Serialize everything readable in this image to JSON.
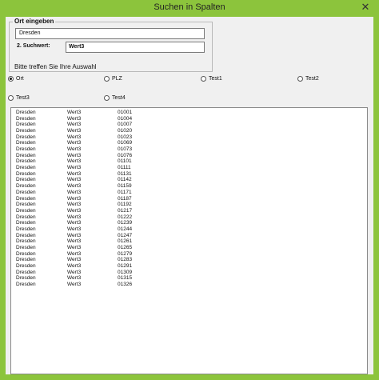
{
  "window": {
    "title": "Suchen in Spalten",
    "close_label": "✕"
  },
  "ort_frame": {
    "label": "Ort eingeben",
    "value": "Dresden"
  },
  "suchwert": {
    "label": "2. Suchwert:",
    "value": "Wert3"
  },
  "prompt": "Bitte treffen Sie Ihre Auswahl",
  "options": [
    {
      "label": "Ort",
      "checked": true
    },
    {
      "label": "PLZ",
      "checked": false
    },
    {
      "label": "Test1",
      "checked": false
    },
    {
      "label": "Test2",
      "checked": false
    },
    {
      "label": "Test3",
      "checked": false
    },
    {
      "label": "Test4",
      "checked": false
    }
  ],
  "results": [
    [
      "Dresden",
      "Wert3",
      "01001"
    ],
    [
      "Dresden",
      "Wert3",
      "01004"
    ],
    [
      "Dresden",
      "Wert3",
      "01007"
    ],
    [
      "Dresden",
      "Wert3",
      "01020"
    ],
    [
      "Dresden",
      "Wert3",
      "01023"
    ],
    [
      "Dresden",
      "Wert3",
      "01069"
    ],
    [
      "Dresden",
      "Wert3",
      "01073"
    ],
    [
      "Dresden",
      "Wert3",
      "01076"
    ],
    [
      "Dresden",
      "Wert3",
      "01101"
    ],
    [
      "Dresden",
      "Wert3",
      "01111"
    ],
    [
      "Dresden",
      "Wert3",
      "01131"
    ],
    [
      "Dresden",
      "Wert3",
      "01142"
    ],
    [
      "Dresden",
      "Wert3",
      "01159"
    ],
    [
      "Dresden",
      "Wert3",
      "01171"
    ],
    [
      "Dresden",
      "Wert3",
      "01187"
    ],
    [
      "Dresden",
      "Wert3",
      "01192"
    ],
    [
      "Dresden",
      "Wert3",
      "01217"
    ],
    [
      "Dresden",
      "Wert3",
      "01222"
    ],
    [
      "Dresden",
      "Wert3",
      "01239"
    ],
    [
      "Dresden",
      "Wert3",
      "01244"
    ],
    [
      "Dresden",
      "Wert3",
      "01247"
    ],
    [
      "Dresden",
      "Wert3",
      "01261"
    ],
    [
      "Dresden",
      "Wert3",
      "01265"
    ],
    [
      "Dresden",
      "Wert3",
      "01279"
    ],
    [
      "Dresden",
      "Wert3",
      "01283"
    ],
    [
      "Dresden",
      "Wert3",
      "01291"
    ],
    [
      "Dresden",
      "Wert3",
      "01309"
    ],
    [
      "Dresden",
      "Wert3",
      "01315"
    ],
    [
      "Dresden",
      "Wert3",
      "01326"
    ]
  ]
}
